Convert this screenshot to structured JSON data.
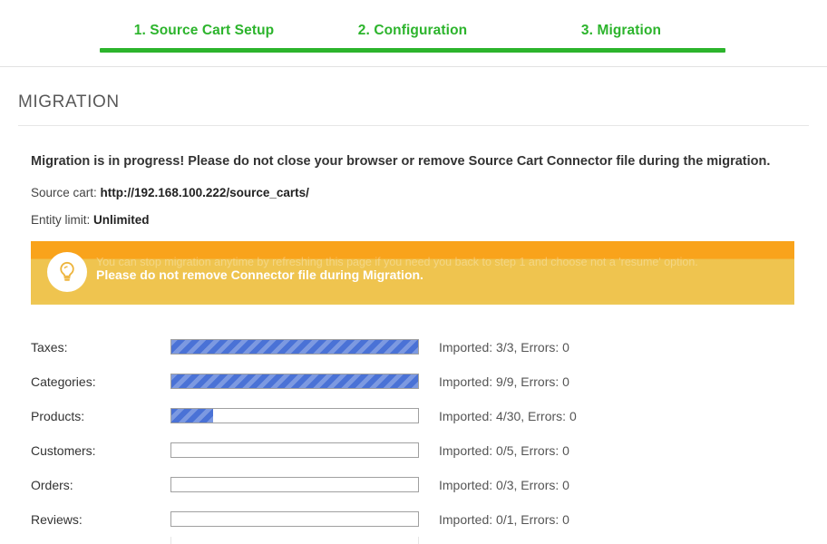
{
  "stepper": {
    "steps": [
      {
        "label": "1. Source Cart Setup"
      },
      {
        "label": "2. Configuration"
      },
      {
        "label": "3. Migration"
      }
    ],
    "accent_color": "#2cb42c"
  },
  "section": {
    "title": "MIGRATION"
  },
  "intro": {
    "headline": "Migration is in progress! Please do not close your browser or remove Source Cart Connector file during the migration.",
    "source_cart_label": "Source cart:",
    "source_cart_value": "http://192.168.100.222/source_carts/",
    "entity_limit_label": "Entity limit:",
    "entity_limit_value": "Unlimited"
  },
  "alert": {
    "icon": "lightbulb-icon",
    "faded_line": "You can stop migration anytime by refreshing this page if you need you back to step 1 and choose not a 'resume' option.",
    "message": "Please do not remove Connector file during Migration.",
    "background_top_color": "#f9a31b",
    "background_body_color": "#efc44f"
  },
  "progress": {
    "status_prefix": "Imported:",
    "errors_prefix": "Errors:",
    "bar_color": "#4a72d6",
    "rows": [
      {
        "label": "Taxes:",
        "imported": 3,
        "total": 3,
        "errors": 0,
        "percent": 100,
        "status": "Imported: 3/3, Errors: 0"
      },
      {
        "label": "Categories:",
        "imported": 9,
        "total": 9,
        "errors": 0,
        "percent": 100,
        "status": "Imported: 9/9, Errors: 0"
      },
      {
        "label": "Products:",
        "imported": 4,
        "total": 30,
        "errors": 0,
        "percent": 17,
        "status": "Imported: 4/30, Errors: 0"
      },
      {
        "label": "Customers:",
        "imported": 0,
        "total": 5,
        "errors": 0,
        "percent": 0,
        "status": "Imported: 0/5, Errors: 0"
      },
      {
        "label": "Orders:",
        "imported": 0,
        "total": 3,
        "errors": 0,
        "percent": 0,
        "status": "Imported: 0/3, Errors: 0"
      },
      {
        "label": "Reviews:",
        "imported": 0,
        "total": 1,
        "errors": 0,
        "percent": 0,
        "status": "Imported: 0/1, Errors: 0"
      }
    ]
  }
}
